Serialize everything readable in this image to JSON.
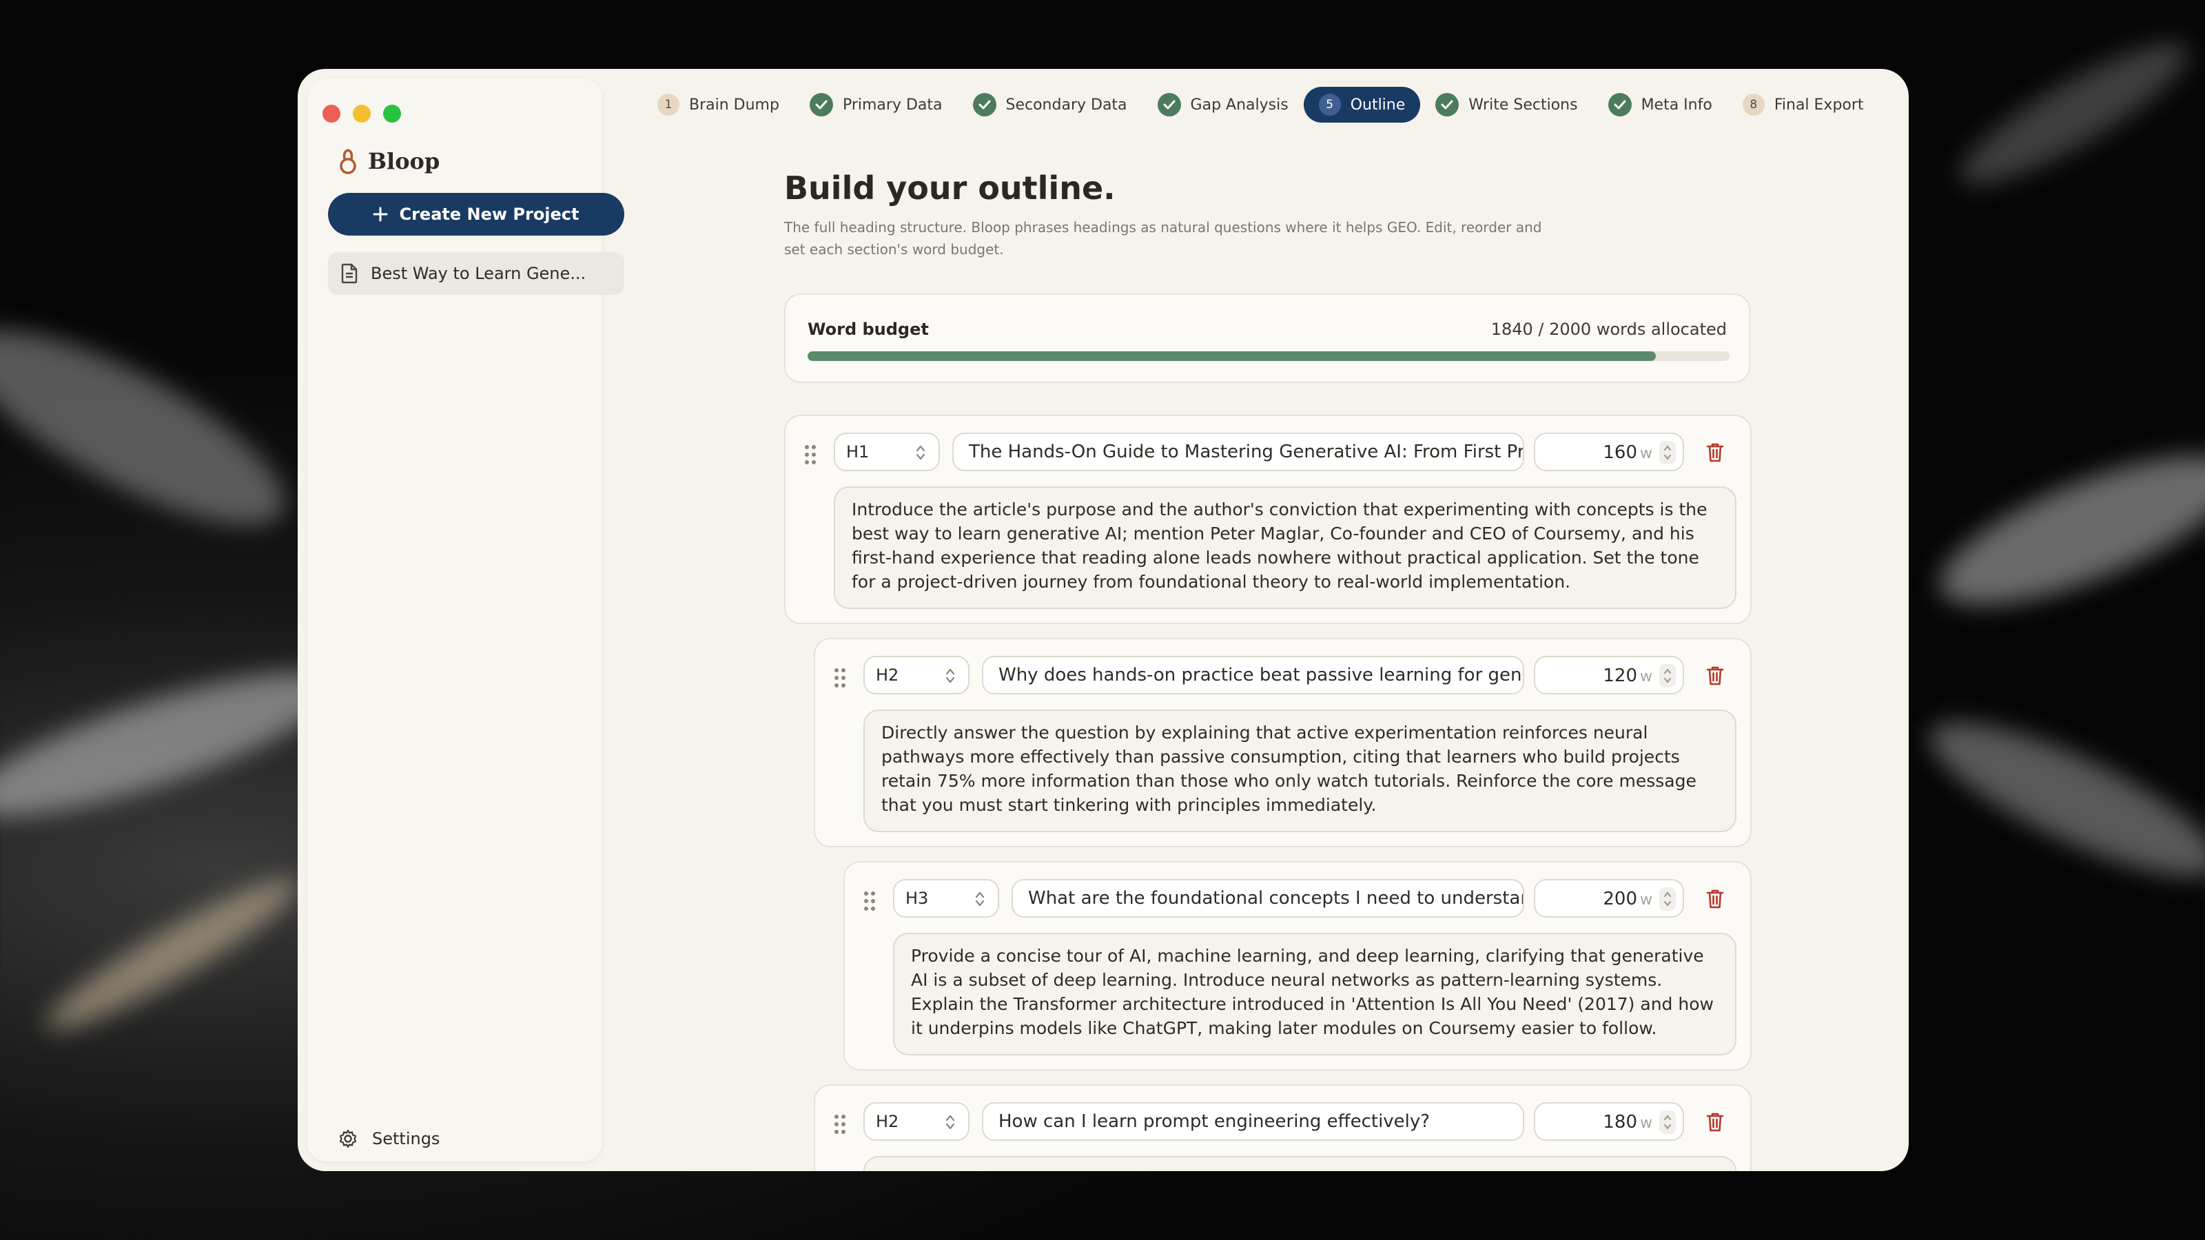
{
  "window": {
    "traffic_lights": {
      "close": "#ec5f57",
      "minimize": "#f4bf2e",
      "maximize": "#29c23f"
    }
  },
  "sidebar": {
    "logo_text": "Bloop",
    "create_button": "Create New Project",
    "projects": [
      {
        "label": "Best Way to Learn Gene..."
      }
    ],
    "settings_label": "Settings"
  },
  "steps": [
    {
      "num": "1",
      "label": "Brain Dump",
      "state": "pending"
    },
    {
      "label": "Primary Data",
      "state": "done"
    },
    {
      "label": "Secondary Data",
      "state": "done"
    },
    {
      "label": "Gap Analysis",
      "state": "done"
    },
    {
      "num": "5",
      "label": "Outline",
      "state": "active"
    },
    {
      "label": "Write Sections",
      "state": "done"
    },
    {
      "label": "Meta Info",
      "state": "done"
    },
    {
      "num": "8",
      "label": "Final Export",
      "state": "pending"
    }
  ],
  "main": {
    "title": "Build your outline.",
    "subtitle": "The full heading structure. Bloop phrases headings as natural questions where it helps GEO. Edit, reorder and set each section's word budget.",
    "budget": {
      "label": "Word budget",
      "count_text": "1840 / 2000 words allocated",
      "allocated": 1840,
      "total": 2000
    },
    "sections": [
      {
        "level": "H1",
        "heading": "The Hands-On Guide to Mastering Generative AI: From First Pri",
        "words": "160",
        "unit": "w",
        "description": "Introduce the article's purpose and the author's conviction that experimenting with concepts is the best way to learn generative AI; mention Peter Maglar, Co-founder and CEO of Coursemy, and his first-hand experience that reading alone leads nowhere without practical application. Set the tone for a project-driven journey from foundational theory to real-world implementation."
      },
      {
        "level": "H2",
        "heading": "Why does hands-on practice beat passive learning for gene",
        "words": "120",
        "unit": "w",
        "description": "Directly answer the question by explaining that active experimentation reinforces neural pathways more effectively than passive consumption, citing that learners who build projects retain 75% more information than those who only watch tutorials. Reinforce the core message that you must start tinkering with principles immediately."
      },
      {
        "level": "H3",
        "heading": "What are the foundational concepts I need to understar",
        "words": "200",
        "unit": "w",
        "description": "Provide a concise tour of AI, machine learning, and deep learning, clarifying that generative AI is a subset of deep learning. Introduce neural networks as pattern-learning systems. Explain the Transformer architecture introduced in 'Attention Is All You Need' (2017) and how it underpins models like ChatGPT, making later modules on Coursemy easier to follow."
      },
      {
        "level": "H2",
        "heading": "How can I learn prompt engineering effectively?",
        "words": "180",
        "unit": "w",
        "description": ""
      }
    ]
  },
  "colors": {
    "accent": "#193a63",
    "done": "#4c7c5b",
    "budget_fill": "#5c8b6a",
    "trash": "#b3392c"
  }
}
